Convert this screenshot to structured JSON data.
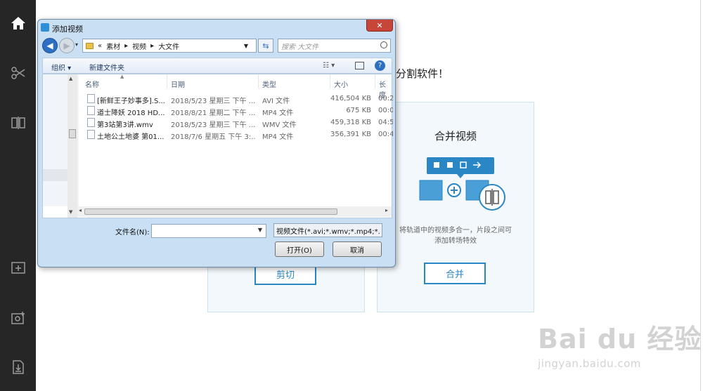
{
  "app": {
    "headline_tail": "分割软件！",
    "merge_card": {
      "title": "合并视频",
      "desc_line1": "将轨道中的视频多合一，片段之间可",
      "desc_line2": "添加转场特效",
      "button": "合并"
    },
    "split_card": {
      "button": "剪切"
    },
    "accent_color": "#2a86c4"
  },
  "sidebar_icons": [
    "home-icon",
    "scissors-icon",
    "split-icon",
    "add-folder-icon",
    "settings-box-icon",
    "export-icon"
  ],
  "dialog": {
    "title": "添加视频",
    "close_label": "✕",
    "breadcrumb": [
      "«",
      "素材",
      "▸",
      "视频",
      "▸",
      "大文件"
    ],
    "search_placeholder": "搜索 大文件",
    "toolbar": {
      "organize": "组织 ▾",
      "new_folder": "新建文件夹"
    },
    "columns": {
      "name": "名称",
      "date": "日期",
      "type": "类型",
      "size": "大小",
      "length": "长度"
    },
    "files": [
      {
        "name": "[新鲜王子妙事多].S...",
        "date": "2018/5/23 星期三 下午 ...",
        "type": "AVI 文件",
        "size": "416,504 KB",
        "length": "00:2"
      },
      {
        "name": "道士降妖 2018 HD...",
        "date": "2018/8/21 星期二 下午 ...",
        "type": "MP4 文件",
        "size": "675 KB",
        "length": "00:0"
      },
      {
        "name": "第3站第3讲.wmv",
        "date": "2018/5/23 星期三 下午 ...",
        "type": "WMV 文件",
        "size": "459,318 KB",
        "length": "04:5"
      },
      {
        "name": "土地公土地婆 第01...",
        "date": "2018/7/6 星期五 下午 3:...",
        "type": "MP4 文件",
        "size": "356,391 KB",
        "length": "00:4"
      }
    ],
    "filename_label": "文件名(N):",
    "filename_value": "",
    "filetype_value": "视频文件(*.avi;*.wmv;*.mp4;*.",
    "open_button": "打开(O)",
    "cancel_button": "取消"
  },
  "watermark": {
    "brand": "Bai du 经验",
    "url": "jingyan.baidu.com"
  }
}
